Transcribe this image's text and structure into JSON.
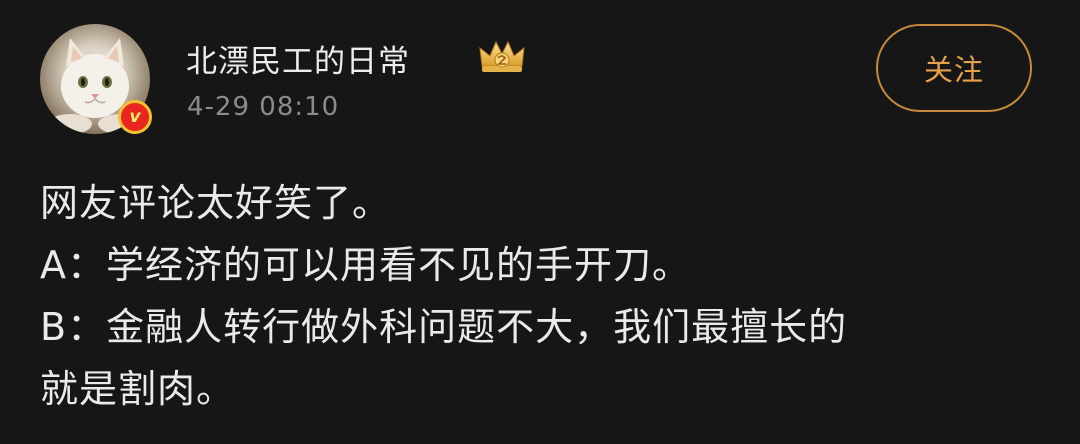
{
  "post": {
    "author": {
      "name": "北漂民工的日常",
      "verified_badge_text": "v",
      "avatar_icon": "cat-avatar",
      "rank_icon": "crown-icon"
    },
    "timestamp": "4-29 08:10",
    "follow_label": "关注",
    "content_lines": [
      "网友评论太好笑了。",
      "A：学经济的可以用看不见的手开刀。",
      "B：金融人转行做外科问题不大，我们最擅长的",
      "就是割肉。"
    ]
  },
  "colors": {
    "background": "#161616",
    "text": "#eaeaea",
    "muted": "#8b8b8b",
    "accent": "#e6a14a",
    "verified": "#e8261f"
  }
}
